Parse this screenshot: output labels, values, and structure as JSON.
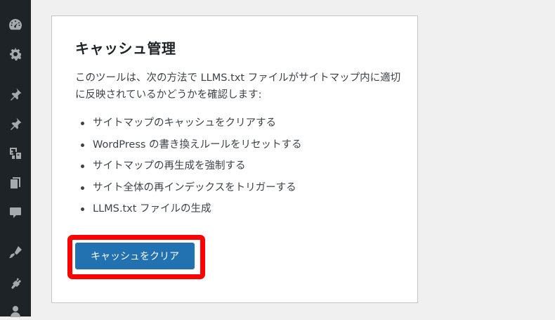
{
  "sidebar": {
    "icons": [
      "dashboard-icon",
      "gear-icon",
      "pin-icon",
      "pin-icon",
      "media-icon",
      "pages-icon",
      "comments-icon",
      "appearance-icon",
      "plugins-icon",
      "users-icon"
    ]
  },
  "card": {
    "title": "キャッシュ管理",
    "description": "このツールは、次の方法で LLMS.txt ファイルがサイトマップ内に適切に反映されているかどうかを確認します:",
    "items": [
      "サイトマップのキャッシュをクリアする",
      "WordPress の書き換えルールをリセットする",
      "サイトマップの再生成を強制する",
      "サイト全体の再インデックスをトリガーする",
      "LLMS.txt ファイルの生成"
    ],
    "button_label": "キャッシュをクリア"
  },
  "colors": {
    "sidebar_bg": "#1d2327",
    "sidebar_icon": "#a7aaad",
    "button_bg": "#2271b1",
    "highlight": "#ff0000"
  }
}
